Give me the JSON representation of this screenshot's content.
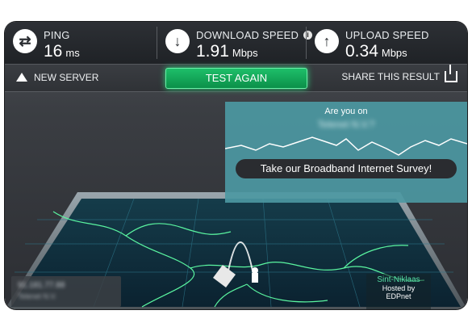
{
  "stats": {
    "ping": {
      "label": "PING",
      "value": "16",
      "unit": "ms",
      "icon": "swap-arrows-icon"
    },
    "download": {
      "label": "DOWNLOAD SPEED",
      "value": "1.91",
      "unit": "Mbps",
      "icon": "arrow-down-icon"
    },
    "upload": {
      "label": "UPLOAD SPEED",
      "value": "0.34",
      "unit": "Mbps",
      "icon": "arrow-up-icon"
    }
  },
  "actions": {
    "new_server": "NEW SERVER",
    "test_again": "TEST AGAIN",
    "share": "SHARE THIS RESULT"
  },
  "survey": {
    "title": "Are you on",
    "isp": "Telenet N.V.?",
    "button": "Take our Broadband Internet Survey!"
  },
  "server": {
    "city": "Sint-Niklaas",
    "hosted_by": "Hosted by",
    "host": "EDPnet"
  },
  "client": {
    "line1": "91.181.77.88",
    "line2": "Telenet N.V."
  },
  "colors": {
    "accent_green": "#1ebf6a",
    "panel_teal": "#4c98a2",
    "map_line": "#5af5a0"
  }
}
